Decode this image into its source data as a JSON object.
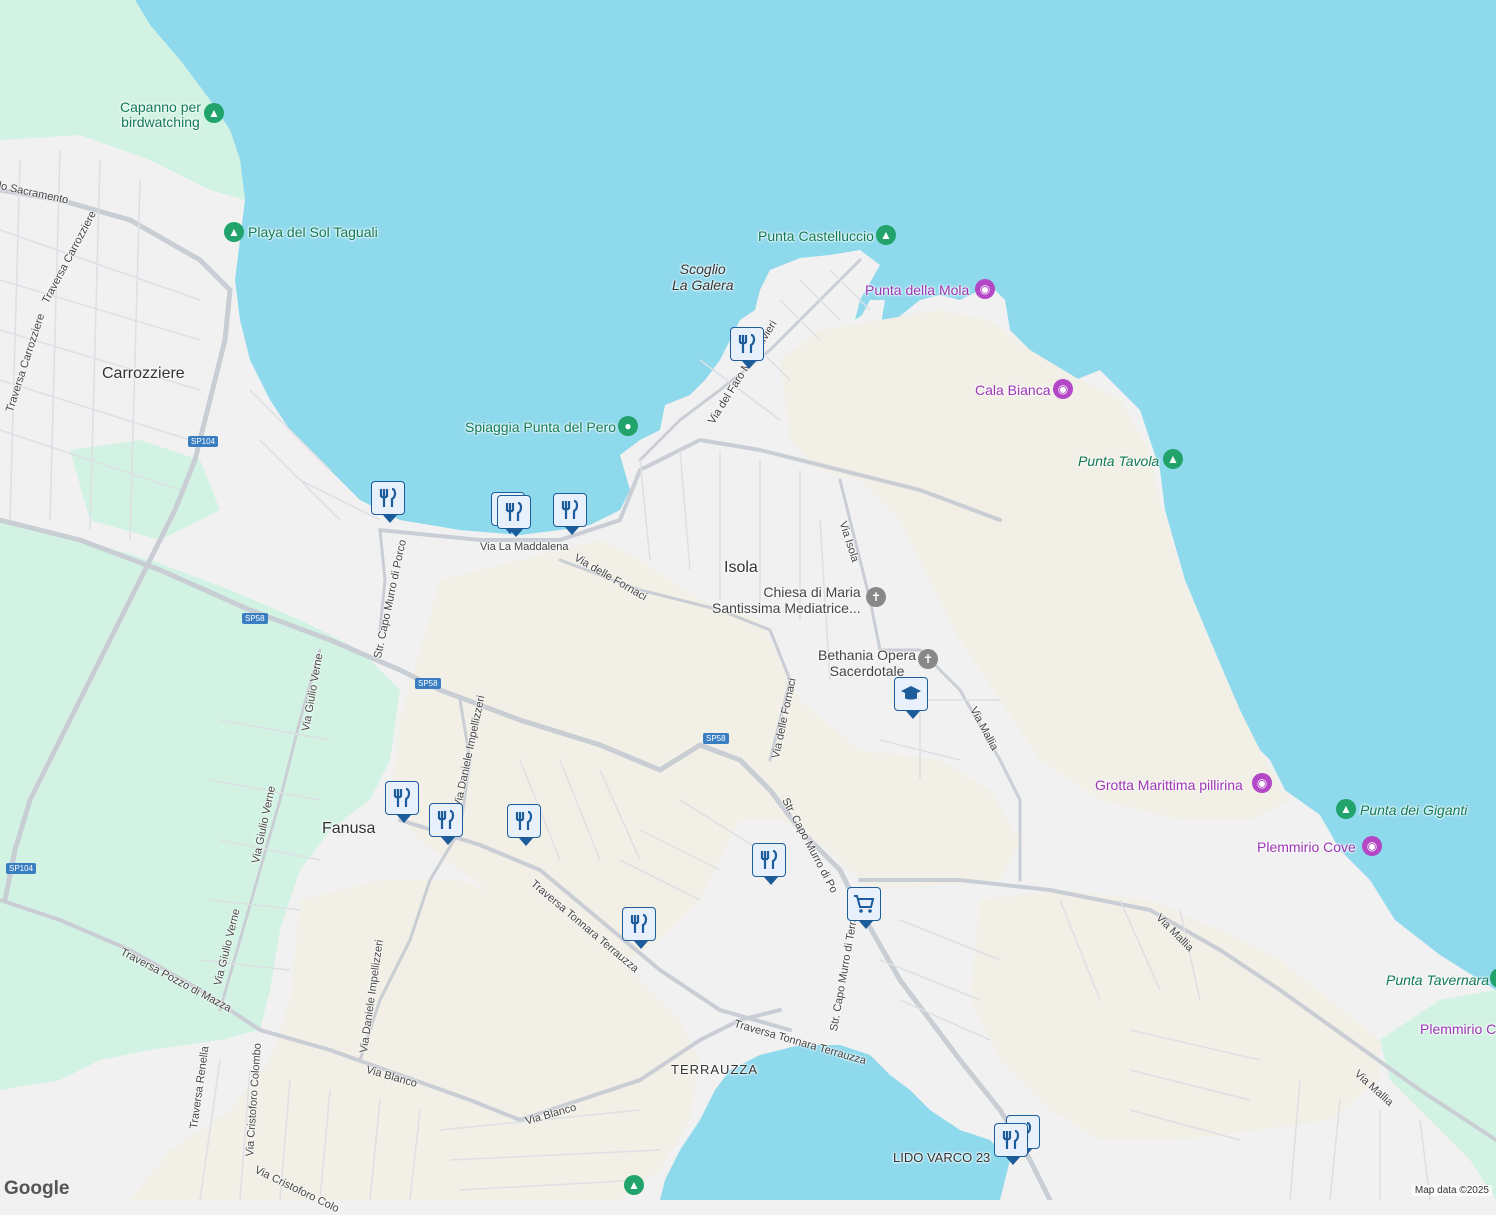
{
  "colors": {
    "water": "#8fd9ec",
    "land": "#f1f1f2",
    "green": "#d2f3e4",
    "sand": "#f2efe6",
    "road": "#c9cdd4",
    "pin": "#1d5c9b"
  },
  "places": {
    "carrozziere": "Carrozziere",
    "isola": "Isola",
    "fanusa": "Fanusa",
    "terrauzza": "TERRAUZZA"
  },
  "water_labels": {
    "scoglio_line1": "Scoglio",
    "scoglio_line2": "La Galera"
  },
  "roads": {
    "sacramento": "lo Sacramento",
    "traversa_carrozziere_1": "Traversa Carrozziere",
    "traversa_carrozziere_2": "Traversa Carrozziere",
    "via_faro": "Via del Faro Massolivieri",
    "via_maddalena": "Via La Maddalena",
    "via_fornaci_1": "Via delle Fornaci",
    "via_isola": "Via Isola",
    "via_fornaci_2": "Via delle Fornaci",
    "via_mallia_1": "Via Mallia",
    "via_mallia_2": "Via Mallia",
    "via_mallia_3": "Via Mallia",
    "capo_murro_1": "Str. Capo Murro di Porco",
    "capo_murro_2": "Str. Capo Murro di Po",
    "via_giulio_verne_1": "Via Giulio Verne",
    "via_giulio_verne_2": "Via Giulio Verne",
    "via_giulio_verne_3": "Via Giulio Verne",
    "daniele_1": "Via Daniele Impellizzeri",
    "daniele_2": "Via Daniele Impellizzeri",
    "tonnara_1": "Traversa Tonnara Terrauzza",
    "tonnara_2": "Traversa Tonnara Terrauzza",
    "capo_terrauzza": "Str. Capo Murro di Terrauzza",
    "pozzo": "Traversa Pozzo di Mazza",
    "renella": "Traversa Renella",
    "colombo_1": "Via Cristoforo Colombo",
    "colombo_2": "Via Cristoforo Colo",
    "via_blanco_1": "Via Blanco",
    "via_blanco_2": "Via Blanco"
  },
  "shields": {
    "sp104_a": "SP104",
    "sp104_b": "SP104",
    "sp58_a": "SP58",
    "sp58_b": "SP58",
    "sp58_c": "SP58"
  },
  "pois": {
    "capanno_1": "Capanno per",
    "capanno_2": "birdwatching",
    "playa": "Playa del Sol Taguali",
    "castelluccio": "Punta Castelluccio",
    "mola": "Punta della Mola",
    "cala_bianca": "Cala Bianca",
    "spiaggia": "Spiaggia Punta del Pero",
    "tavola": "Punta Tavola",
    "chiesa_1": "Chiesa di Maria",
    "chiesa_2": "Santissima Mediatrice...",
    "bethania_1": "Bethania Opera",
    "bethania_2": "Sacerdotale",
    "grotta": "Grotta Marittima pillirina",
    "giganti": "Punta dei Giganti",
    "plemmirio_cove": "Plemmirio Cove",
    "tavernara": "Punta Tavernara",
    "plemmirio_c": "Plemmirio C",
    "lido": "LIDO VARCO 23"
  },
  "icons": {
    "restaurant": "restaurant-icon",
    "school": "school-icon",
    "shopping": "shopping-cart-icon",
    "park": "tree-icon",
    "camera": "camera-icon",
    "church": "cross-icon",
    "beach": "circle-icon"
  },
  "attribution": {
    "logo": "Google",
    "data": "Map data ©2025"
  }
}
